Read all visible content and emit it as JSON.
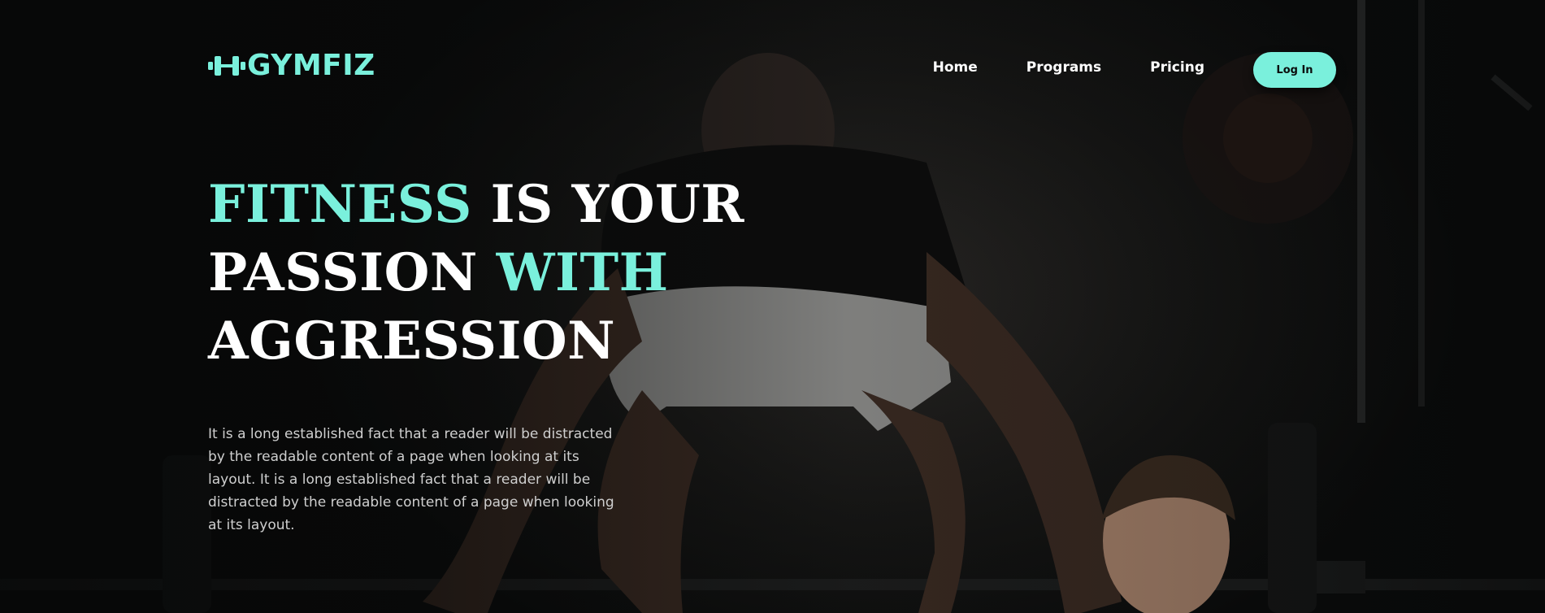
{
  "brand": {
    "name": "GYMFIZ",
    "logo_icon": "dumbbell-icon",
    "accent_color": "#7af0dc"
  },
  "nav": {
    "items": [
      "Home",
      "Programs",
      "Pricing"
    ],
    "login_label": "Log In"
  },
  "hero": {
    "headline": {
      "line1_accent": "FITNESS",
      "line1_rest": " IS YOUR",
      "line2_start": "PASSION ",
      "line2_accent": "WITH",
      "line3": "AGGRESSION"
    },
    "description": "It is a long established fact that a reader will be distracted by the readable content of a page when looking at its layout. It is a long established fact that a reader will be distracted by the readable content of a page when looking at its layout.",
    "background": "weightlifter-photo"
  }
}
